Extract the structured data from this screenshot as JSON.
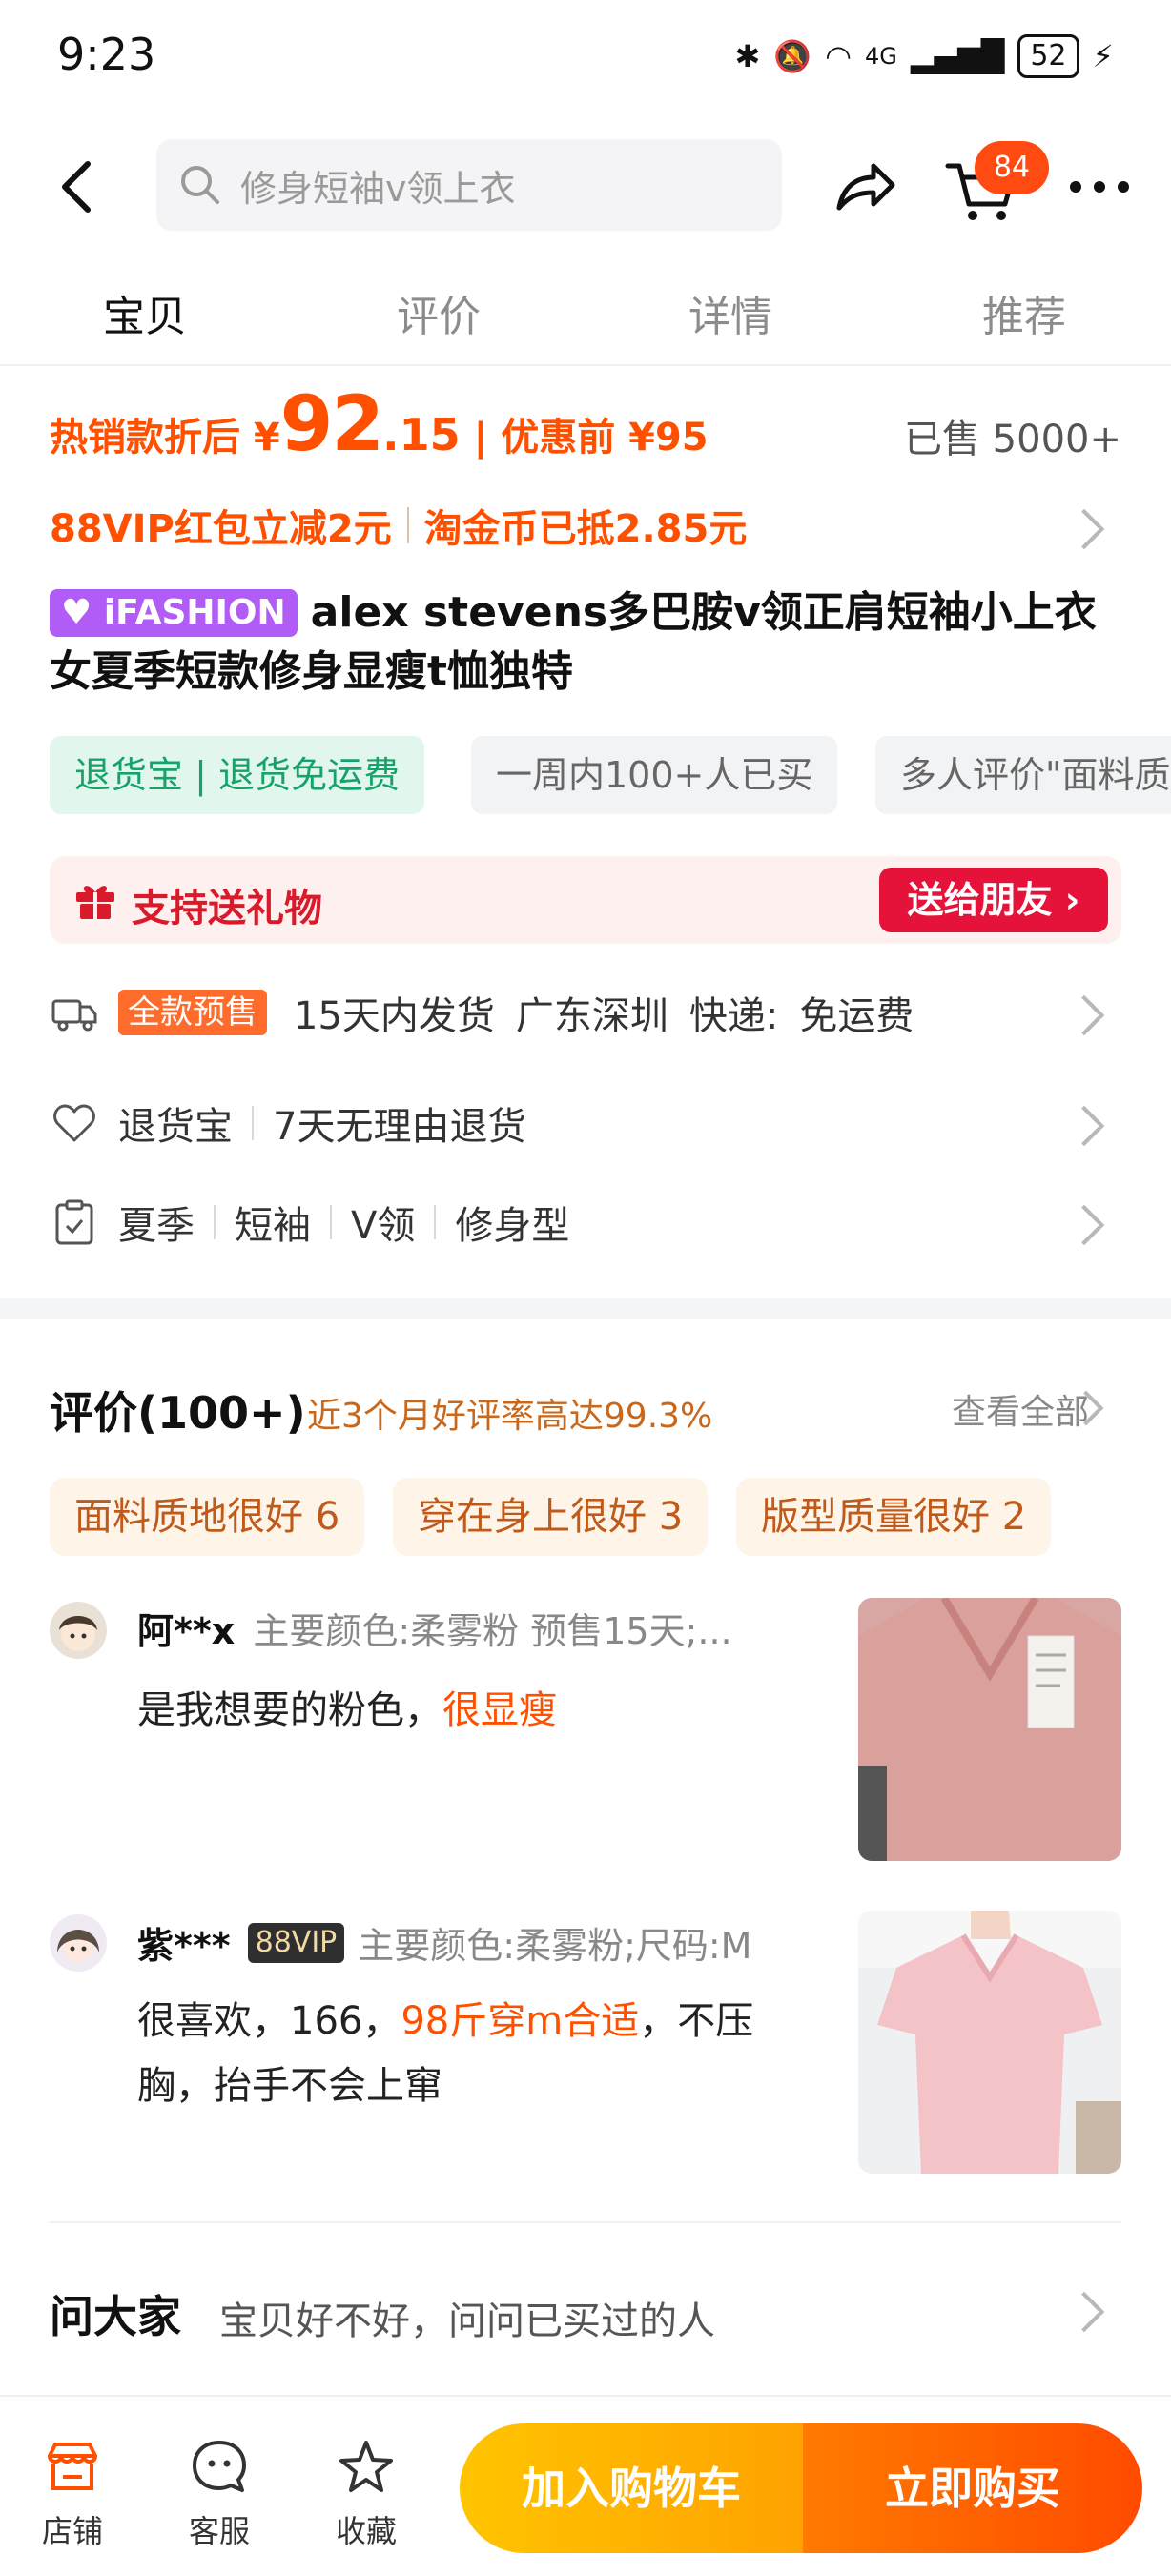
{
  "status_bar": {
    "time": "9:23",
    "network": "4G",
    "battery": "52"
  },
  "top_nav": {
    "search_placeholder": "修身短袖v领上衣",
    "cart_count": "84"
  },
  "tabs": [
    {
      "label": "宝贝",
      "active": true
    },
    {
      "label": "评价",
      "active": false
    },
    {
      "label": "详情",
      "active": false
    },
    {
      "label": "推荐",
      "active": false
    }
  ],
  "price": {
    "prefix": "热销款折后 ¥",
    "integer": "92",
    "decimal": ".15",
    "separator": "|",
    "original": "优惠前 ¥95",
    "sold": "已售 5000+"
  },
  "promo": {
    "vip": "88VIP红包立减2元",
    "coin": "淘金币已抵2.85元"
  },
  "product": {
    "badge": "iFASHION",
    "title": "alex stevens多巴胺v领正肩短袖小上衣女夏季短款修身显瘦t恤独特"
  },
  "tags": [
    "退货宝 | 退货免运费",
    "一周内100+人已买",
    "多人评价\"面料质"
  ],
  "gift": {
    "label": "支持送礼物",
    "button": "送给朋友"
  },
  "shipping": {
    "badge": "全款预售",
    "delivery": "15天内发货",
    "origin": "广东深圳",
    "express": "快递:",
    "fee": "免运费"
  },
  "returns": {
    "label": "退货宝",
    "policy": "7天无理由退货"
  },
  "attributes": [
    "夏季",
    "短袖",
    "V领",
    "修身型"
  ],
  "reviews": {
    "title": "评价(100+)",
    "subtitle": "近3个月好评率高达99.3%",
    "view_all": "查看全部",
    "chips": [
      "面料质地很好 6",
      "穿在身上很好 3",
      "版型质量很好 2"
    ],
    "items": [
      {
        "user": "阿**x",
        "meta": "主要颜色:柔雾粉 预售15天;...",
        "text_plain": "是我想要的粉色，",
        "text_highlight": "很显瘦"
      },
      {
        "user": "紫***",
        "vip": "88VIP",
        "meta": "主要颜色:柔雾粉;尺码:M",
        "text_a": "很喜欢，166，",
        "text_highlight": "98斤穿m合适",
        "text_b": "，不压",
        "text_c": "胸，抬手不会上窜"
      }
    ]
  },
  "ask": {
    "title": "问大家",
    "subtitle": "宝贝好不好，问问已买过的人"
  },
  "bottom_bar": {
    "shop": "店铺",
    "service": "客服",
    "favorite": "收藏",
    "add_cart": "加入购物车",
    "buy_now": "立即购买"
  },
  "colors": {
    "accent": "#ff5000",
    "gift_red": "#e5133a",
    "cart_yellow": "#ffb000"
  }
}
